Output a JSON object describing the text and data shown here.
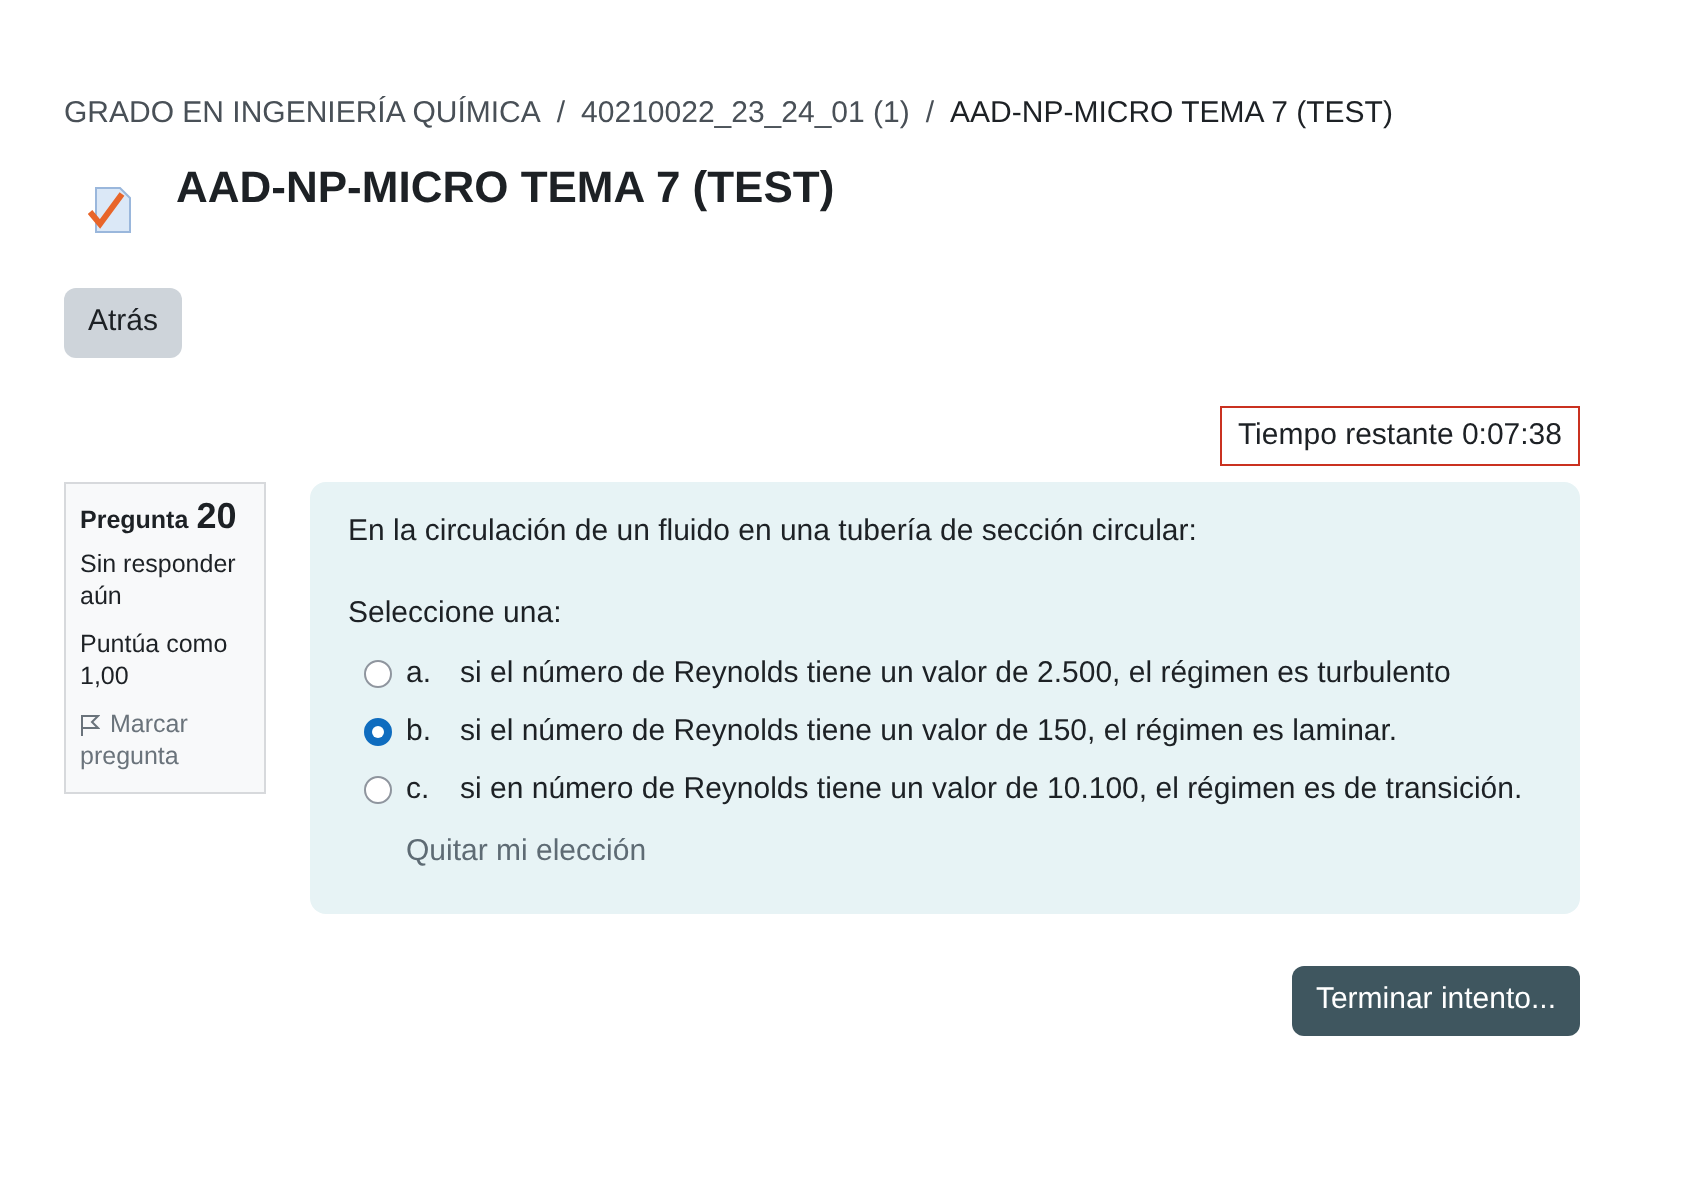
{
  "breadcrumb": [
    "GRADO EN INGENIERÍA QUÍMICA",
    "40210022_23_24_01 (1)",
    "AAD-NP-MICRO TEMA 7 (TEST)"
  ],
  "breadcrumb_separator": "/",
  "title": "AAD-NP-MICRO TEMA 7 (TEST)",
  "back_button": "Atrás",
  "timer": "Tiempo restante 0:07:38",
  "question_info": {
    "label": "Pregunta",
    "number": "20",
    "status": "Sin responder aún",
    "grade": "Puntúa como 1,00",
    "flag": "Marcar pregunta"
  },
  "question": {
    "text": "En la circulación de un fluido en una tubería de sección circular:",
    "prompt": "Seleccione una:",
    "options": [
      {
        "letter": "a.",
        "text": "si el número de Reynolds tiene un valor de 2.500, el régimen es turbulento",
        "selected": false
      },
      {
        "letter": "b.",
        "text": "si el número de Reynolds tiene un valor de 150, el régimen es laminar.",
        "selected": true
      },
      {
        "letter": "c.",
        "text": "si en número de Reynolds tiene un valor de 10.100, el régimen es de transición.",
        "selected": false
      }
    ],
    "clear_link": "Quitar mi elección"
  },
  "finish_button": "Terminar intento..."
}
